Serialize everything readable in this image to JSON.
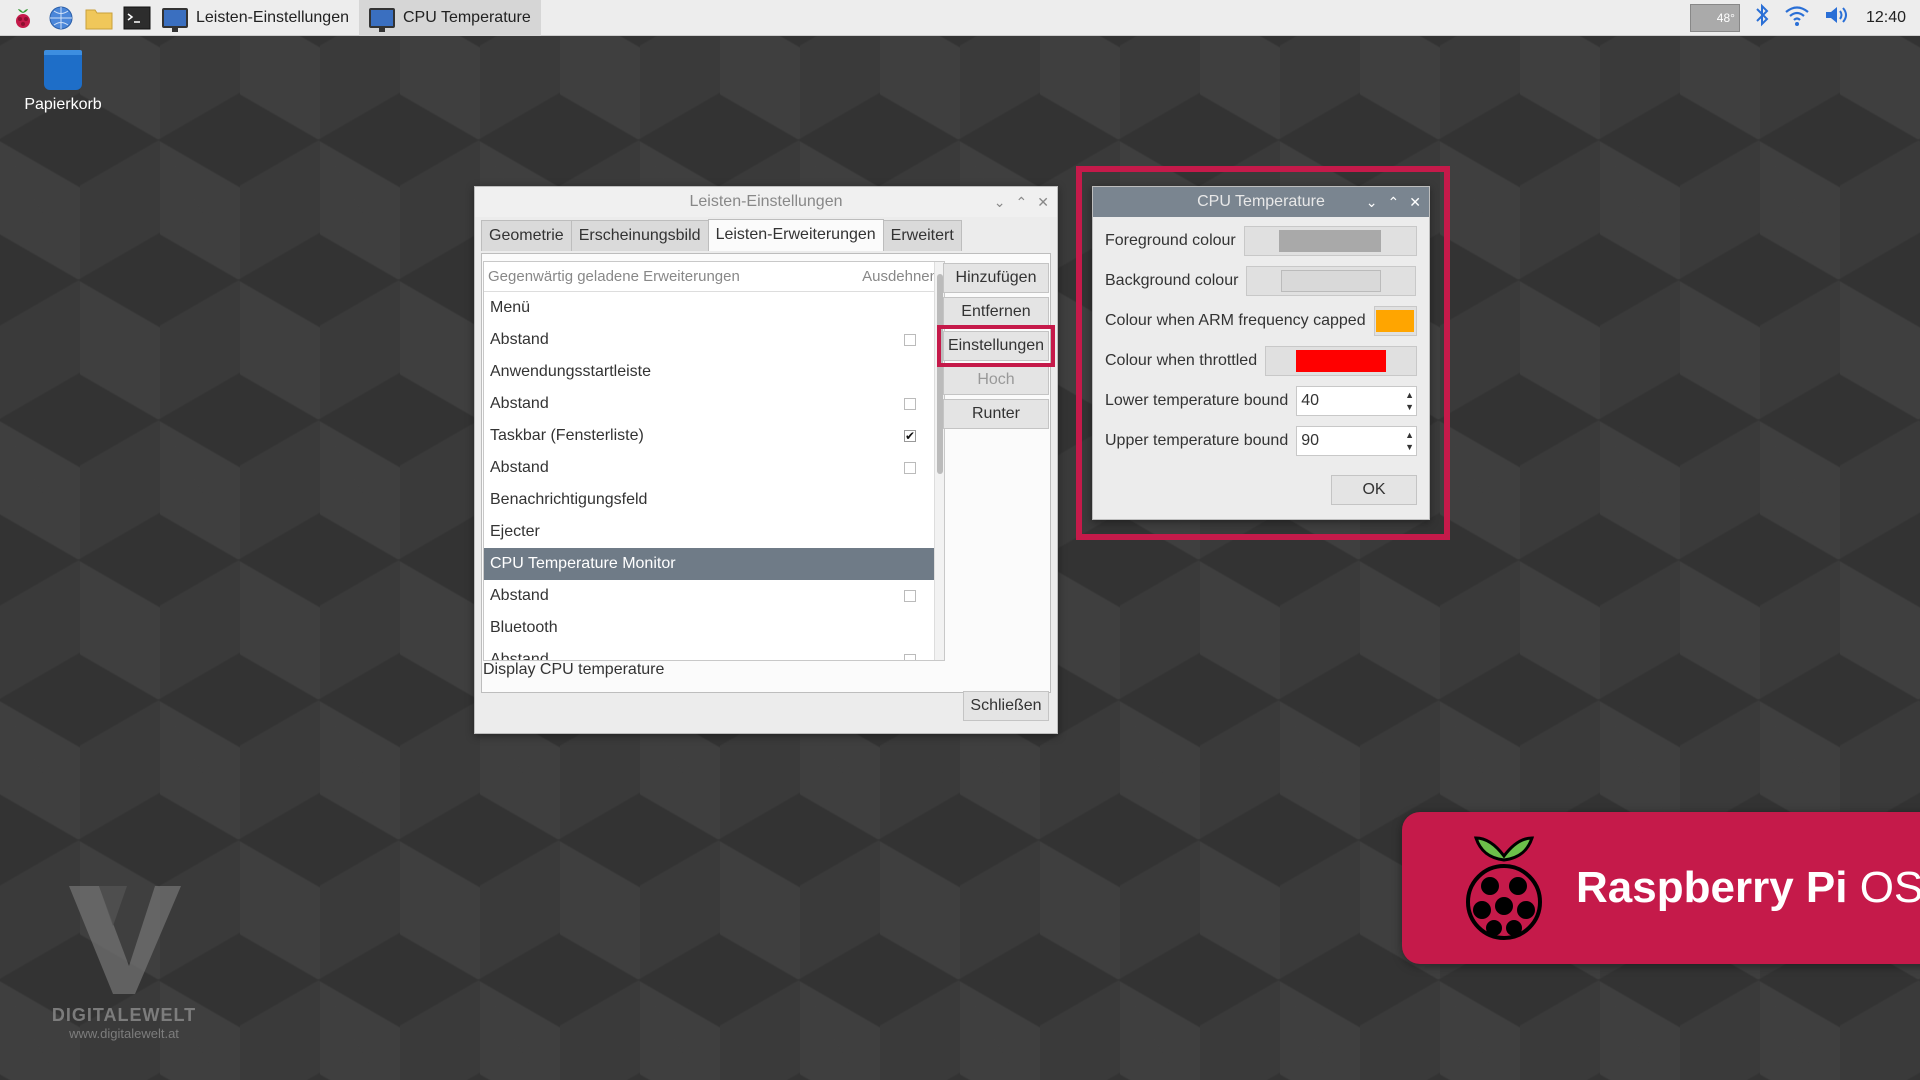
{
  "taskbar": {
    "tasks": [
      {
        "label": "Leisten-Einstellungen"
      },
      {
        "label": "CPU Temperature"
      }
    ],
    "tray_temp": "48°",
    "clock": "12:40"
  },
  "desktop": {
    "trash_label": "Papierkorb"
  },
  "panel_settings": {
    "title": "Leisten-Einstellungen",
    "tabs": [
      "Geometrie",
      "Erscheinungsbild",
      "Leisten-Erweiterungen",
      "Erweitert"
    ],
    "list_header": "Gegenwärtig geladene Erweiterungen",
    "list_expand_header": "Ausdehnen",
    "items": [
      {
        "label": "Menü",
        "checkbox": "none"
      },
      {
        "label": "Abstand",
        "checkbox": "off"
      },
      {
        "label": "Anwendungsstartleiste",
        "checkbox": "none"
      },
      {
        "label": "Abstand",
        "checkbox": "off"
      },
      {
        "label": "Taskbar (Fensterliste)",
        "checkbox": "on"
      },
      {
        "label": "Abstand",
        "checkbox": "off"
      },
      {
        "label": "Benachrichtigungsfeld",
        "checkbox": "none"
      },
      {
        "label": "Ejecter",
        "checkbox": "none"
      },
      {
        "label": "CPU Temperature Monitor",
        "checkbox": "none",
        "selected": true
      },
      {
        "label": "Abstand",
        "checkbox": "off"
      },
      {
        "label": "Bluetooth",
        "checkbox": "none"
      },
      {
        "label": "Abstand",
        "checkbox": "off"
      }
    ],
    "buttons": {
      "add": "Hinzufügen",
      "remove": "Entfernen",
      "settings": "Einstellungen",
      "up": "Hoch",
      "down": "Runter"
    },
    "description": "Display CPU temperature",
    "close_label": "Schließen"
  },
  "cpu_temp": {
    "title": "CPU Temperature",
    "fg_label": "Foreground colour",
    "fg_color": "#a9a9a9",
    "bg_label": "Background colour",
    "bg_color": "#d9d9d9",
    "arm_label": "Colour when ARM frequency capped",
    "arm_color": "#ffa500",
    "throttle_label": "Colour when throttled",
    "throttle_color": "#ff0000",
    "lower_label": "Lower temperature bound",
    "lower_value": "40",
    "upper_label": "Upper temperature bound",
    "upper_value": "90",
    "ok_label": "OK"
  },
  "branding": {
    "rpi_bold": "Raspberry Pi",
    "rpi_light": "OS",
    "rpi_color": "#c51a4a",
    "watermark_word": "DIGITALEWELT",
    "watermark_url": "www.digitalewelt.at"
  }
}
